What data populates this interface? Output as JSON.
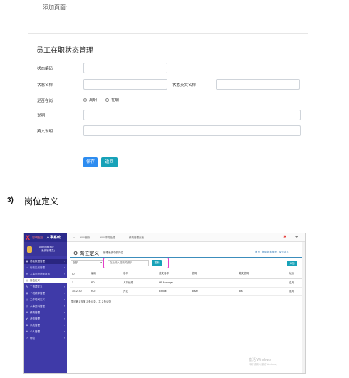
{
  "caption": "添加页面:",
  "form": {
    "title": "员工在职状态管理",
    "labels": {
      "code": "状态编码",
      "name": "状态名称",
      "name_en": "状态英文名称",
      "on_job": "是否在岗",
      "description": "说明",
      "en_description": "英文说明"
    },
    "radio_options": [
      "离职",
      "在职"
    ],
    "radio_selected": "在职",
    "save_label": "保存",
    "back_label": "返回"
  },
  "section": {
    "number": "3)",
    "title": "岗位定义"
  },
  "app": {
    "logo_letter": "X",
    "logo_text": "思明宏业",
    "app_name": "人事系统",
    "user_name": "Administrator",
    "user_role": "(系统管理员)",
    "sidebar": [
      {
        "label": "基础数据管理",
        "icon": "▦",
        "style": "active"
      },
      {
        "label": "行政区划管理",
        "icon": "♀",
        "style": "sub"
      },
      {
        "label": "人事系统基础数据",
        "icon": "✣",
        "style": "sub"
      },
      {
        "label": "岗位定义",
        "icon": "◎",
        "style": "selected"
      },
      {
        "label": "工资项定义",
        "icon": "✎",
        "style": ""
      },
      {
        "label": "个税税率管理",
        "icon": "▤",
        "style": ""
      },
      {
        "label": "工作时间定义",
        "icon": "◷",
        "style": ""
      },
      {
        "label": "人事资料管理",
        "icon": "◇",
        "style": ""
      },
      {
        "label": "薪资管理",
        "icon": "¥",
        "style": ""
      },
      {
        "label": "考勤管理",
        "icon": "✔",
        "style": ""
      },
      {
        "label": "系统管理",
        "icon": "⚙",
        "style": ""
      },
      {
        "label": "个人管理",
        "icon": "♟",
        "style": ""
      },
      {
        "label": "帮助",
        "icon": "?",
        "style": ""
      }
    ],
    "topnav": [
      "KPI 首页",
      "KPI 事务处理",
      "薪资管理页面"
    ],
    "page_title": "岗位定义",
    "page_subtitle": "管理系统中的岗位",
    "breadcrumb": "首页 / 基础数据管理 / 岗位定义",
    "select_value": "全部",
    "search_placeholder": "在此输入搜索关键字",
    "search_label": "搜索",
    "add_label": "添加",
    "table": {
      "headers": [
        "ID",
        "编码",
        "名称",
        "英文名称",
        "说明",
        "英文说明",
        "状态"
      ],
      "rows": [
        [
          "1",
          "R01",
          "人事经理",
          "HR Manager",
          "",
          "",
          "启用"
        ],
        [
          "1012190",
          "R02",
          "开发",
          "Exploit",
          "adsaf",
          "ads",
          "禁用"
        ]
      ]
    },
    "pager": "显示第 1 至第 2 条记录，共 2 条记录",
    "watermark": "激活 Windows",
    "watermark_sub": "转到\"设置\"以激活 Windows。"
  }
}
